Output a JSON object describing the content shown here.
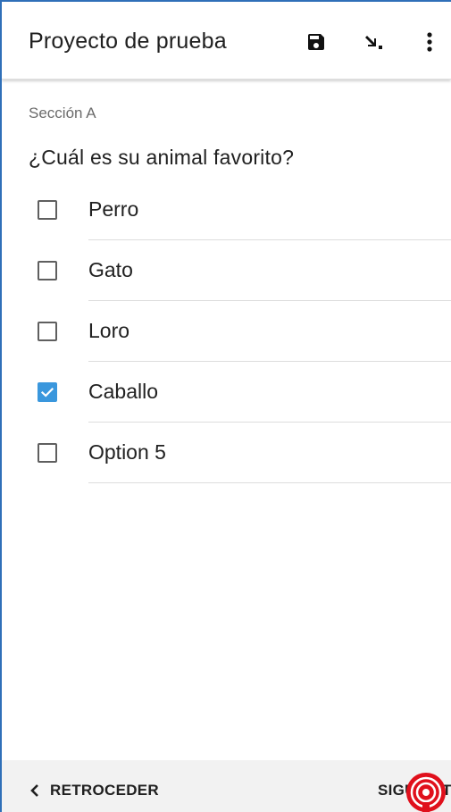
{
  "appbar": {
    "title": "Proyecto de prueba",
    "icons": [
      "save-icon",
      "goto-icon",
      "more-vert-icon"
    ]
  },
  "form": {
    "section": "Sección A",
    "question": "¿Cuál es su animal favorito?",
    "options": [
      {
        "label": "Perro",
        "checked": false
      },
      {
        "label": "Gato",
        "checked": false
      },
      {
        "label": "Loro",
        "checked": false
      },
      {
        "label": "Caballo",
        "checked": true
      },
      {
        "label": "Option 5",
        "checked": false
      }
    ]
  },
  "navigation": {
    "back_label": "RETROCEDER",
    "next_label": "SIGUIENTE"
  },
  "colors": {
    "accent": "#3a97dd",
    "touch_indicator": "#e0101c",
    "frame_border": "#2f6fb8"
  }
}
